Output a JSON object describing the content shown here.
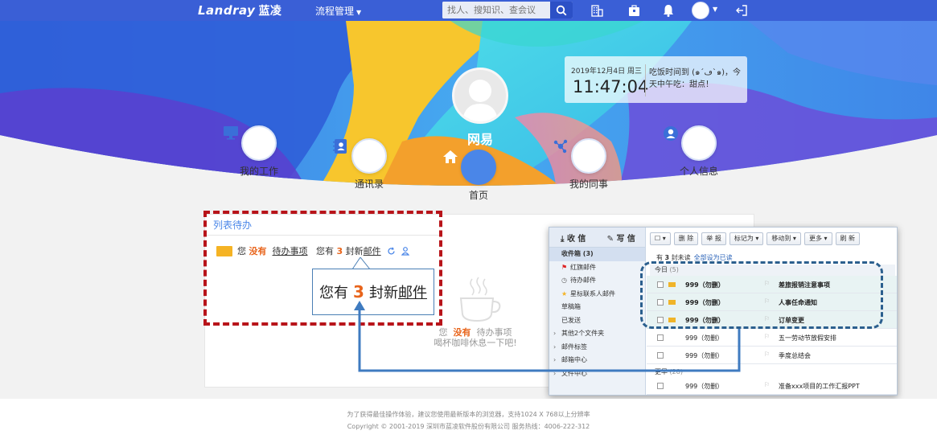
{
  "topbar": {
    "logo_text": "Landray",
    "logo_cn": "蓝凌",
    "menu_label": "流程管理",
    "search_placeholder": "找人、搜知识、查会议"
  },
  "profile": {
    "name": "网易"
  },
  "clock": {
    "date": "2019年12月4日",
    "weekday": "周三",
    "time": "11:47:04",
    "message": "吃饭时间到 (๑´ڡ`๑)，今天中午吃：甜点！"
  },
  "nav": [
    {
      "label": "我的工作",
      "icon": "monitor-icon"
    },
    {
      "label": "通讯录",
      "icon": "contacts-icon"
    },
    {
      "label": "首页",
      "icon": "home-icon"
    },
    {
      "label": "我的同事",
      "icon": "share-icon"
    },
    {
      "label": "个人信息",
      "icon": "user-icon"
    }
  ],
  "todo_panel": {
    "title": "列表待办",
    "you": "您",
    "none": "没有",
    "todo_items": "待办事项",
    "you_have": "您有",
    "count": "3",
    "new_mail_prefix": "封新",
    "mail_word": "邮件",
    "empty_line1_you": "您",
    "empty_line1_none": "没有",
    "empty_line1_todo": "待办事项",
    "empty_line2": "喝杯咖啡休息一下吧!"
  },
  "callout": {
    "you_have": "您有",
    "count": "3",
    "new": "封新",
    "mail": "邮件"
  },
  "mail": {
    "receive": "收 信",
    "compose": "写 信",
    "folders": [
      {
        "label": "收件箱 (3)",
        "active": true,
        "arrow": false
      },
      {
        "label": "红旗邮件",
        "active": false,
        "arrow": false
      },
      {
        "label": "待办邮件",
        "active": false,
        "arrow": false
      },
      {
        "label": "星标联系人邮件",
        "active": false,
        "arrow": false
      },
      {
        "label": "草稿箱",
        "active": false,
        "arrow": false
      },
      {
        "label": "已发送",
        "active": false,
        "arrow": false
      },
      {
        "label": "其他2个文件夹",
        "active": false,
        "arrow": true
      },
      {
        "label": "邮件标签",
        "active": false,
        "arrow": true
      },
      {
        "label": "邮箱中心",
        "active": false,
        "arrow": true
      },
      {
        "label": "文件中心",
        "active": false,
        "arrow": true
      }
    ],
    "toolbar": [
      "删 除",
      "举 报",
      "标记为",
      "移动到",
      "更多",
      "刷 新"
    ],
    "info_prefix": "有",
    "info_count": "3",
    "info_suffix": "封未读",
    "info_link": "全部设为已读",
    "group_today": "今日",
    "group_today_count": "(5)",
    "group_earlier": "更早",
    "group_earlier_count": "(28)",
    "rows": [
      {
        "from": "999（勿删）",
        "subject": "差旅报销注意事项",
        "unread": true
      },
      {
        "from": "999（勿删）",
        "subject": "人事任命通知",
        "unread": true
      },
      {
        "from": "999（勿删）",
        "subject": "订单变更",
        "unread": true
      },
      {
        "from": "999（勿删）",
        "subject": "五一劳动节放假安排",
        "unread": false
      },
      {
        "from": "999（勿删）",
        "subject": "季度总结会",
        "unread": false
      },
      {
        "from": "999（勿删）",
        "subject": "准备xxx项目的工作汇报PPT",
        "unread": false
      }
    ]
  },
  "footer": {
    "line1": "为了获得最佳操作体验，建议您使用最新版本的浏览器，支持1024 X 768以上分辨率",
    "line2": "Copyright © 2001-2019 深圳市蓝凌软件股份有限公司 服务热线：4006-222-312"
  }
}
